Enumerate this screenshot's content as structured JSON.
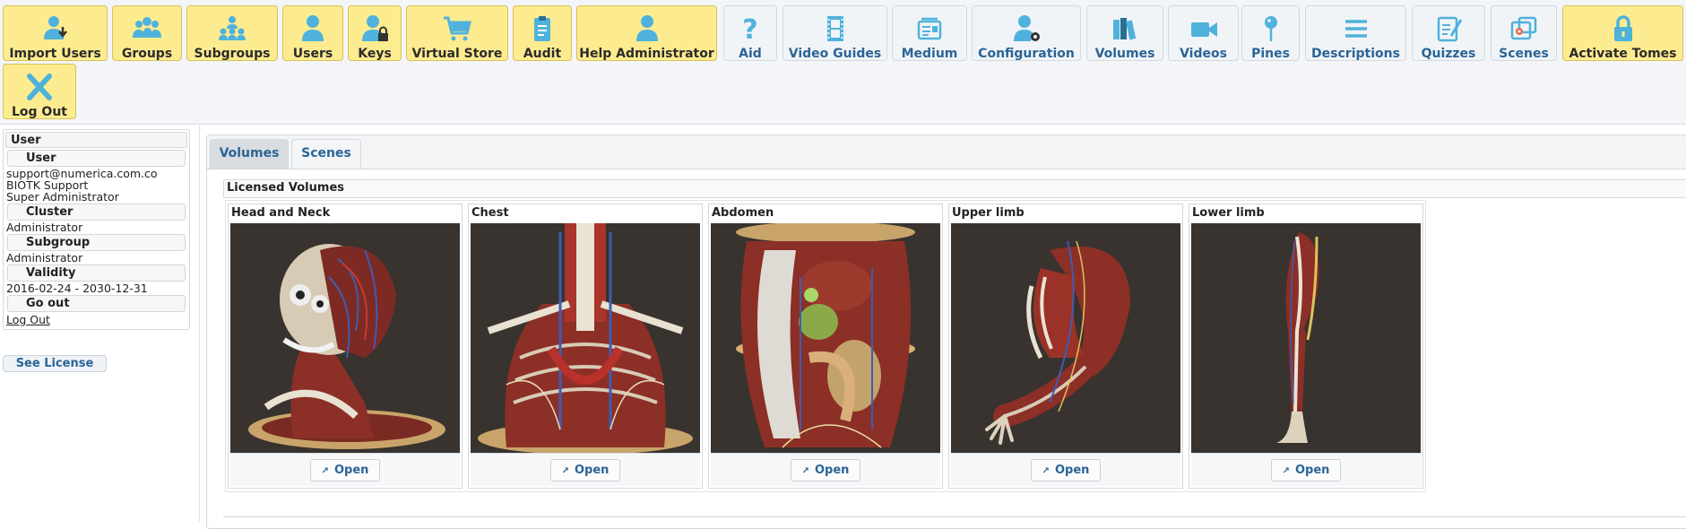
{
  "toolbar": {
    "row1": [
      {
        "label": "Import Users",
        "icon": "import-users-icon",
        "color": "yellow"
      },
      {
        "label": "Groups",
        "icon": "groups-icon",
        "color": "yellow"
      },
      {
        "label": "Subgroups",
        "icon": "subgroups-icon",
        "color": "yellow"
      },
      {
        "label": "Users",
        "icon": "user-icon",
        "color": "yellow"
      },
      {
        "label": "Keys",
        "icon": "user-lock-icon",
        "color": "yellow"
      },
      {
        "label": "Virtual Store",
        "icon": "cart-icon",
        "color": "yellow"
      },
      {
        "label": "Audit",
        "icon": "clipboard-icon",
        "color": "yellow"
      },
      {
        "label": "Help Administrator",
        "icon": "user-icon",
        "color": "yellow"
      },
      {
        "label": "Aid",
        "icon": "question-icon",
        "color": "blue"
      },
      {
        "label": "Video Guides",
        "icon": "film-icon",
        "color": "blue"
      },
      {
        "label": "Medium",
        "icon": "media-icon",
        "color": "blue"
      },
      {
        "label": "Configuration",
        "icon": "user-gear-icon",
        "color": "blue"
      },
      {
        "label": "Volumes",
        "icon": "books-icon",
        "color": "blue"
      },
      {
        "label": "Videos",
        "icon": "video-camera-icon",
        "color": "blue"
      },
      {
        "label": "Pines",
        "icon": "pin-icon",
        "color": "blue"
      },
      {
        "label": "Descriptions",
        "icon": "lines-icon",
        "color": "blue"
      },
      {
        "label": "Quizzes",
        "icon": "quiz-icon",
        "color": "blue"
      },
      {
        "label": "Scenes",
        "icon": "scenes-icon",
        "color": "blue"
      },
      {
        "label": "Activate Tomes",
        "icon": "lock-icon",
        "color": "yellow"
      }
    ],
    "logout": {
      "label": "Log Out",
      "icon": "close-icon",
      "color": "yellow"
    }
  },
  "sidebar": {
    "header": "User",
    "user_heading": "User",
    "email": "support@numerica.com.co",
    "name": "BIOTK Support",
    "role": "Super Administrator",
    "cluster_heading": "Cluster",
    "cluster_value": "Administrator",
    "subgroup_heading": "Subgroup",
    "subgroup_value": "Administrator",
    "validity_heading": "Validity",
    "validity_value": "2016-02-24 - 2030-12-31",
    "goout_heading": "Go out",
    "logout_link": "Log Out",
    "see_license": "See License"
  },
  "tabs": [
    {
      "label": "Volumes",
      "active": true
    },
    {
      "label": "Scenes",
      "active": false
    }
  ],
  "licensed_heading": "Licensed Volumes",
  "volumes": [
    {
      "title": "Head and Neck",
      "open": "Open"
    },
    {
      "title": "Chest",
      "open": "Open"
    },
    {
      "title": "Abdomen",
      "open": "Open"
    },
    {
      "title": "Upper limb",
      "open": "Open"
    },
    {
      "title": "Lower limb",
      "open": "Open"
    }
  ],
  "colors": {
    "yellow_button": "#fdec8f",
    "blue_button": "#f1f4f7",
    "icon_blue": "#4fb2dc",
    "link_blue": "#2a6496",
    "image_bg": "#38332e"
  }
}
